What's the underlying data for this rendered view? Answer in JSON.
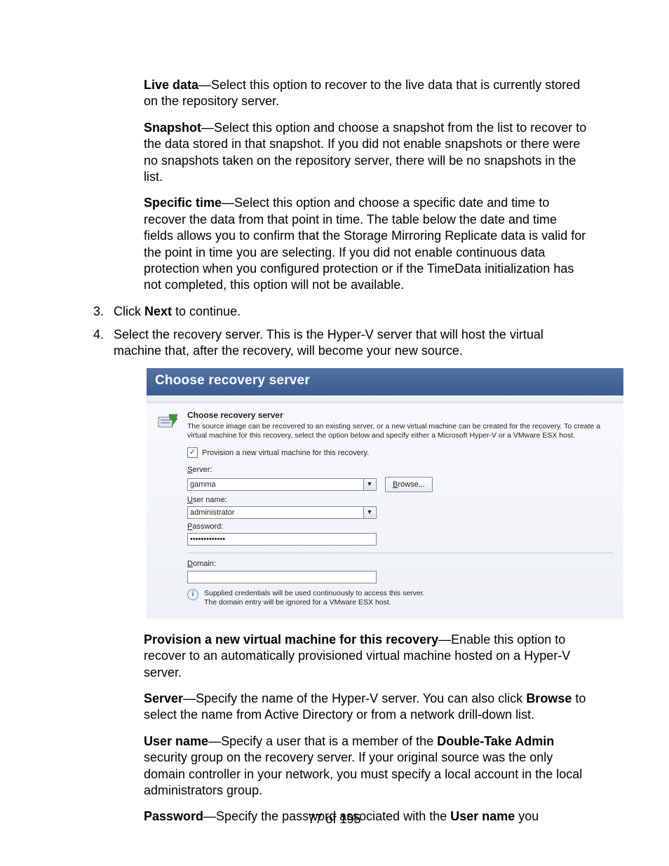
{
  "content": {
    "live_data_label": "Live data",
    "live_data_text": "—Select this option to recover to the live data that is currently stored on the repository server.",
    "snapshot_label": "Snapshot",
    "snapshot_text": "—Select this option and choose a snapshot from the list to recover to the data stored in that snapshot. If you did not enable snapshots or there were no snapshots taken on the repository server, there will be no snapshots in the list.",
    "specific_time_label": "Specific time",
    "specific_time_text": "—Select this option and choose a specific date and time to recover the data from that point in time. The table below the date and time fields allows you to confirm that the Storage Mirroring Replicate data is valid for the point in time you are selecting. If you did not enable continuous data protection when you configured protection or if the TimeData initialization has not completed, this option will not be available.",
    "step3_num": "3.",
    "step3_pre": "Click ",
    "step3_bold": "Next",
    "step3_post": " to continue.",
    "step4_num": "4.",
    "step4_text": "Select the recovery server. This is the Hyper-V server that will host the virtual machine that, after the recovery, will become your new source.",
    "provision_label": "Provision a new virtual machine for this recovery",
    "provision_text": "—Enable this option to recover to an automatically provisioned virtual machine hosted on a Hyper-V server.",
    "server_label": "Server",
    "server_text_pre": "—Specify the name of the Hyper-V server. You can also click ",
    "server_text_bold": "Browse",
    "server_text_post": " to select the name from Active Directory or from a network drill-down list.",
    "username_label": "User name",
    "username_text_pre": "—Specify a user that is a member of the ",
    "username_text_bold": "Double-Take Admin",
    "username_text_post": " security group on the recovery server. If your original source was the only domain controller in your network, you must specify a local account in the local administrators group.",
    "password_label": "Password",
    "password_text_pre": "—Specify the password associated with the ",
    "password_text_bold": "User name",
    "password_text_post": " you"
  },
  "dialog": {
    "title": "Choose recovery server",
    "heading": "Choose recovery server",
    "description": "The source image can be recovered to an existing server, or a new virtual machine can be created for the recovery.  To create a virtual machine for this recovery, select the option below and specify either a Microsoft Hyper-V or a VMware ESX host.",
    "checkbox_label": "Provision a new virtual machine for this recovery.",
    "checkbox_checked": "✓",
    "server_label_u": "S",
    "server_label_rest": "erver:",
    "server_value": "gamma",
    "browse_u": "B",
    "browse_rest": "rowse...",
    "username_label_u": "U",
    "username_label_rest": "ser name:",
    "username_value": "administrator",
    "password_label_u": "P",
    "password_label_rest": "assword:",
    "password_value": "•••••••••••••",
    "domain_label_u": "D",
    "domain_label_rest": "omain:",
    "domain_value": "",
    "info_line1": "Supplied credentials will be used continuously to access this server.",
    "info_line2": "The domain entry will be ignored for a VMware ESX host.",
    "info_glyph": "i",
    "dropdown_glyph": "▼"
  },
  "footer": {
    "page_number": "77 of 195"
  }
}
